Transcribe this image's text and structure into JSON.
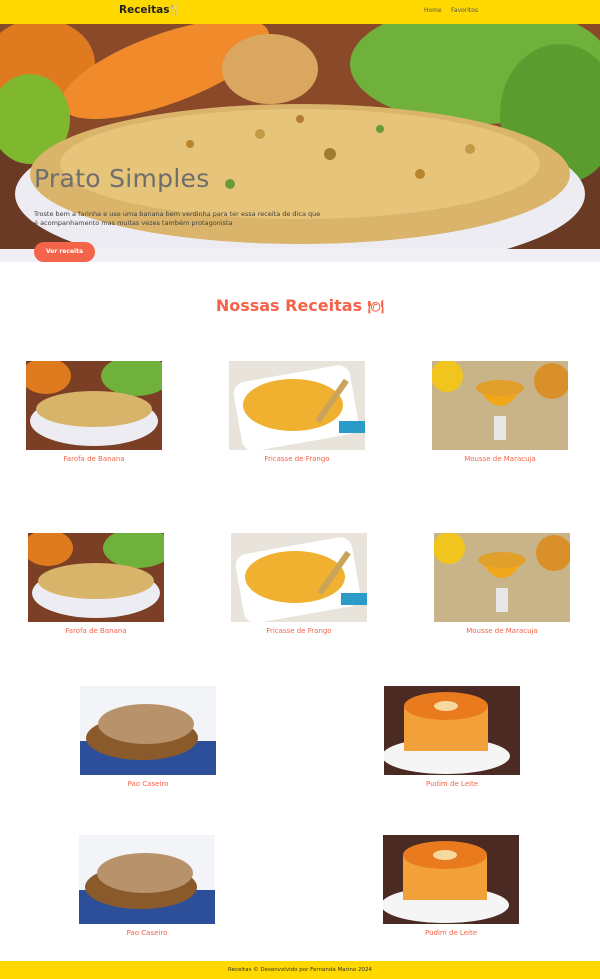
{
  "header": {
    "brand": "Receitas",
    "brand_icon": "fork-knife-icon",
    "nav": [
      "Home",
      "Favoritos"
    ]
  },
  "hero": {
    "title": "Prato Simples",
    "text": "Troste bem a farinha e use uma banana bem verdinha para ter essa receita de dica que é acompanhamento mas muitas vezes também protagonista",
    "button": "Ver receita"
  },
  "section": {
    "title": "Nossas Receitas",
    "icon": "plate-icon"
  },
  "recipes": [
    {
      "name": "Farofa de Banana"
    },
    {
      "name": "Fricasse de Frango"
    },
    {
      "name": "Mousse de Maracuja"
    },
    {
      "name": "Farofa de Banana"
    },
    {
      "name": "Fricasse de Frango"
    },
    {
      "name": "Mousse de Maracuja"
    },
    {
      "name": "Pao Caseiro"
    },
    {
      "name": "Pudim de Leite"
    },
    {
      "name": "Pao Caseiro"
    },
    {
      "name": "Pudim de Leite"
    }
  ],
  "footer": {
    "text": "Receitas © Desenvolvido por Fernanda Marino 2024"
  },
  "colors": {
    "header_bg": "#ffd800",
    "accent": "#f4644a"
  }
}
